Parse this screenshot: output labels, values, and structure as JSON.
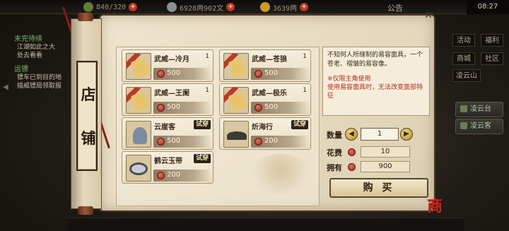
{
  "topbar": {
    "resource_1": "840/320",
    "resource_2": "6928两902文",
    "resource_3": "3639两",
    "announcement": "公告",
    "clock": "08:27"
  },
  "quest": {
    "title_1": "未完待续",
    "text_1a": "江湖如此之大",
    "text_1b": "处去看看",
    "title_2": "运镖",
    "text_2a": "镖车已到目的地",
    "text_2b": "插威镖局领取报"
  },
  "side_menu": {
    "btn_1": "活动",
    "btn_2": "福利",
    "btn_3": "商城",
    "btn_4": "社区",
    "location": "凌云山",
    "tab_1": "凌云台",
    "tab_2": "凌云客"
  },
  "shop": {
    "title_char_1": "店",
    "title_char_2": "铺",
    "close_icon": "close-icon",
    "currency_icon": "red-coin-icon",
    "try_label": "试穿",
    "items": [
      {
        "name": "武威—冷月",
        "qty": "1",
        "price": "500",
        "tryable": false
      },
      {
        "name": "武威—苍狼",
        "qty": "1",
        "price": "500",
        "tryable": false
      },
      {
        "name": "武威—王阑",
        "qty": "1",
        "price": "500",
        "tryable": false
      },
      {
        "name": "武威—极乐",
        "qty": "1",
        "price": "500",
        "tryable": false
      },
      {
        "name": "云崖客",
        "qty": "",
        "price": "500",
        "tryable": true
      },
      {
        "name": "炘海行",
        "qty": "",
        "price": "200",
        "tryable": true
      },
      {
        "name": "鹤云玉带",
        "qty": "",
        "price": "200",
        "tryable": true
      }
    ],
    "description": {
      "text": "不知何人所缝制的易容面具，一个苍老、褶皱的易容像。",
      "note_1": "※仅限主角使用",
      "note_2": "使用易容面具时，无法改变面部特征"
    },
    "purchase": {
      "quantity_label": "数量",
      "quantity_value": "1",
      "cost_label": "花费",
      "cost_value": "10",
      "owned_label": "拥有",
      "owned_value": "900",
      "buy_label": "购 买"
    }
  },
  "colors": {
    "accent_red": "#b42a1c",
    "panel_bg": "#e6dac0",
    "frame": "#4a3626"
  },
  "logo": "商"
}
